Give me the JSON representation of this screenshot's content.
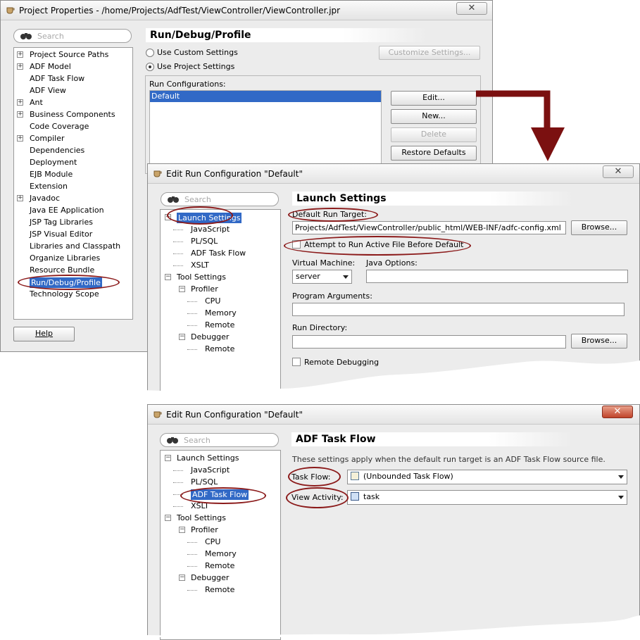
{
  "window1": {
    "title": "Project Properties - /home/Projects/AdfTest/ViewController/ViewController.jpr",
    "search_placeholder": "Search",
    "nav_items": [
      {
        "label": "Project Source Paths",
        "expandable": true
      },
      {
        "label": "ADF Model",
        "expandable": true
      },
      {
        "label": "ADF Task Flow",
        "expandable": false
      },
      {
        "label": "ADF View",
        "expandable": false
      },
      {
        "label": "Ant",
        "expandable": true
      },
      {
        "label": "Business Components",
        "expandable": true
      },
      {
        "label": "Code Coverage",
        "expandable": false
      },
      {
        "label": "Compiler",
        "expandable": true
      },
      {
        "label": "Dependencies",
        "expandable": false
      },
      {
        "label": "Deployment",
        "expandable": false
      },
      {
        "label": "EJB Module",
        "expandable": false
      },
      {
        "label": "Extension",
        "expandable": false
      },
      {
        "label": "Javadoc",
        "expandable": true
      },
      {
        "label": "Java EE Application",
        "expandable": false
      },
      {
        "label": "JSP Tag Libraries",
        "expandable": false
      },
      {
        "label": "JSP Visual Editor",
        "expandable": false
      },
      {
        "label": "Libraries and Classpath",
        "expandable": false
      },
      {
        "label": "Organize Libraries",
        "expandable": false
      },
      {
        "label": "Resource Bundle",
        "expandable": false
      },
      {
        "label": "Run/Debug/Profile",
        "expandable": false,
        "selected": true
      },
      {
        "label": "Technology Scope",
        "expandable": false
      }
    ],
    "help_button": "Help",
    "section_title": "Run/Debug/Profile",
    "radio_custom": "Use Custom Settings",
    "radio_project": "Use Project Settings",
    "customize_button": "Customize Settings...",
    "run_configs_label": "Run Configurations:",
    "run_configs": [
      "Default"
    ],
    "edit_button": "Edit...",
    "new_button": "New...",
    "delete_button": "Delete",
    "restore_button": "Restore Defaults"
  },
  "window2": {
    "title": "Edit Run Configuration \"Default\"",
    "search_placeholder": "Search",
    "tree": {
      "launch_settings": "Launch Settings",
      "javascript": "JavaScript",
      "plsql": "PL/SQL",
      "adf_task_flow": "ADF Task Flow",
      "xslt": "XSLT",
      "tool_settings": "Tool Settings",
      "profiler": "Profiler",
      "cpu": "CPU",
      "memory": "Memory",
      "remote": "Remote",
      "debugger": "Debugger",
      "debugger_remote": "Remote"
    },
    "section_title": "Launch Settings",
    "default_run_target_label": "Default Run Target:",
    "default_run_target_value": "Projects/AdfTest/ViewController/public_html/WEB-INF/adfc-config.xml",
    "browse_button": "Browse...",
    "attempt_checkbox": "Attempt to Run Active File Before Default",
    "virtual_machine_label": "Virtual Machine:",
    "virtual_machine_value": "server",
    "java_options_label": "Java Options:",
    "program_arguments_label": "Program Arguments:",
    "run_directory_label": "Run Directory:",
    "browse_button2": "Browse...",
    "remote_debugging_checkbox": "Remote Debugging"
  },
  "window3": {
    "title": "Edit Run Configuration \"Default\"",
    "search_placeholder": "Search",
    "tree": {
      "launch_settings": "Launch Settings",
      "javascript": "JavaScript",
      "plsql": "PL/SQL",
      "adf_task_flow": "ADF Task Flow",
      "xslt": "XSLT",
      "tool_settings": "Tool Settings",
      "profiler": "Profiler",
      "cpu": "CPU",
      "memory": "Memory",
      "remote": "Remote",
      "debugger": "Debugger",
      "debugger_remote": "Remote"
    },
    "section_title": "ADF Task Flow",
    "description": "These settings apply when the default run target is an ADF Task Flow source file.",
    "task_flow_label": "Task Flow:",
    "task_flow_value": "(Unbounded Task Flow)",
    "view_activity_label": "View Activity:",
    "view_activity_value": "task"
  },
  "colors": {
    "selection": "#3169c6",
    "annotation": "#8b1a1a",
    "dialog_bg": "#ececec"
  }
}
